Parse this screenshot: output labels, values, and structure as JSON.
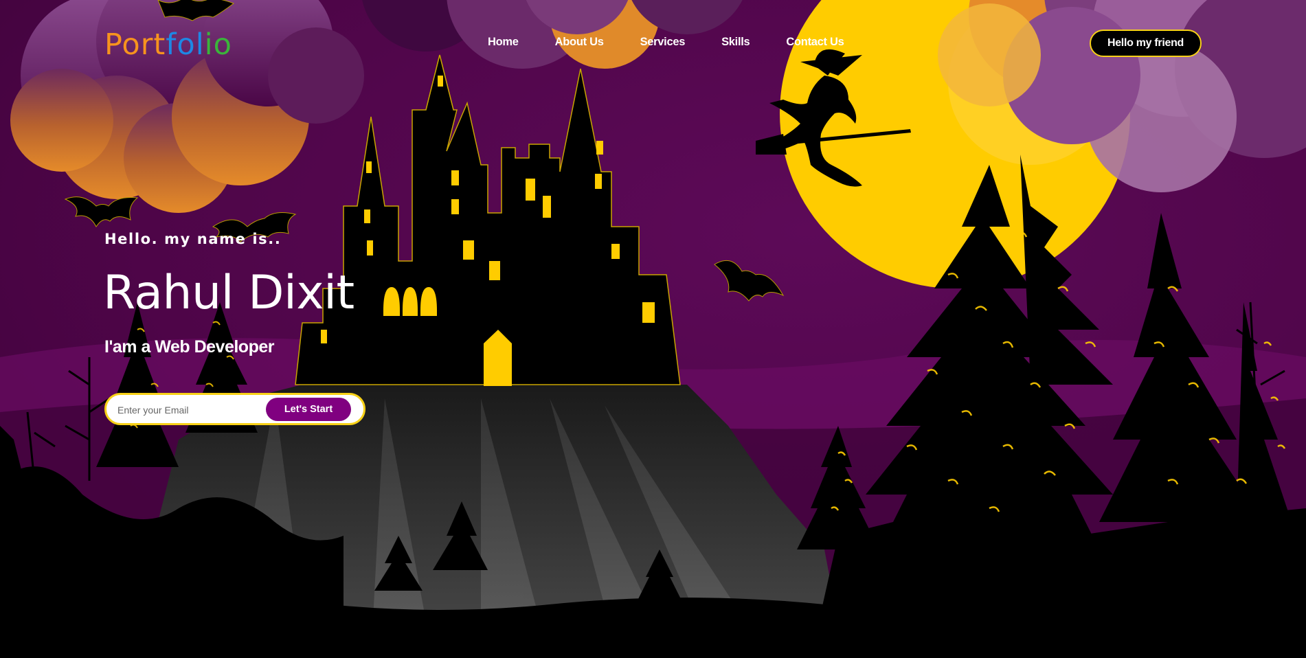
{
  "logo": {
    "letters": [
      {
        "text": "Port",
        "color": "#f7931e"
      },
      {
        "text": "fol",
        "color": "#1e88e5"
      },
      {
        "text": "io",
        "color": "#3bb43b"
      }
    ]
  },
  "nav": {
    "items": [
      {
        "label": "Home"
      },
      {
        "label": "About Us"
      },
      {
        "label": "Services"
      },
      {
        "label": "Skills"
      },
      {
        "label": "Contact Us"
      }
    ],
    "cta_label": "Hello my friend"
  },
  "hero": {
    "greeting": "Hello. my name is..",
    "name": "Rahul Dixit",
    "role": "I'am a Web Developer",
    "email_placeholder": "Enter your Email",
    "email_value": "",
    "start_label": "Let's Start"
  },
  "colors": {
    "sky": "#52064c",
    "moon": "#ffcc00",
    "accent": "#f7d117",
    "button": "#800080",
    "silhouette": "#000000"
  },
  "icons": [
    "moon",
    "witch",
    "castle",
    "bat",
    "pine-tree",
    "cloud"
  ]
}
